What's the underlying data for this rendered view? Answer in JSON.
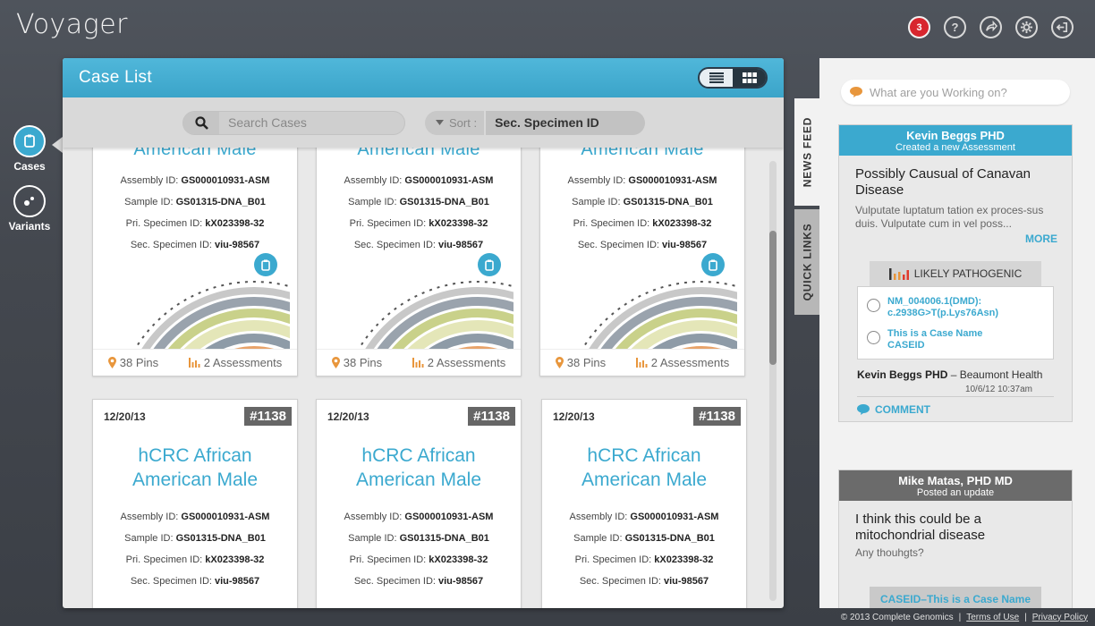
{
  "app": {
    "title": "Voyager"
  },
  "topbar": {
    "notification_count": "3",
    "icons": [
      "notifications-icon",
      "help-icon",
      "share-icon",
      "settings-icon",
      "logout-icon"
    ]
  },
  "leftnav": {
    "items": [
      {
        "label": "Cases",
        "active": true
      },
      {
        "label": "Variants",
        "active": false
      }
    ]
  },
  "case_list": {
    "title": "Case List",
    "search_placeholder": "Search Cases",
    "sort_label": "Sort :",
    "sort_value": "Sec. Specimen ID",
    "top_cards": [
      {
        "title_fragment": "American Male",
        "assembly_label": "Assembly ID:",
        "assembly": "GS000010931-ASM",
        "sample_label": "Sample ID:",
        "sample": "GS01315-DNA_B01",
        "pri_label": "Pri. Specimen ID:",
        "pri": "kX023398-32",
        "sec_label": "Sec. Specimen ID:",
        "sec": "viu-98567",
        "pins": "38 Pins",
        "assessments": "2 Assessments"
      },
      {
        "title_fragment": "American Male",
        "assembly_label": "Assembly ID:",
        "assembly": "GS000010931-ASM",
        "sample_label": "Sample ID:",
        "sample": "GS01315-DNA_B01",
        "pri_label": "Pri. Specimen ID:",
        "pri": "kX023398-32",
        "sec_label": "Sec. Specimen ID:",
        "sec": "viu-98567",
        "pins": "38 Pins",
        "assessments": "2 Assessments"
      },
      {
        "title_fragment": "American Male",
        "assembly_label": "Assembly ID:",
        "assembly": "GS000010931-ASM",
        "sample_label": "Sample ID:",
        "sample": "GS01315-DNA_B01",
        "pri_label": "Pri. Specimen ID:",
        "pri": "kX023398-32",
        "sec_label": "Sec. Specimen ID:",
        "sec": "viu-98567",
        "pins": "38 Pins",
        "assessments": "2 Assessments"
      }
    ],
    "bottom_cards": [
      {
        "date": "12/20/13",
        "id": "#1138",
        "title_line1": "hCRC African",
        "title_line2": "American Male",
        "assembly_label": "Assembly ID:",
        "assembly": "GS000010931-ASM",
        "sample_label": "Sample ID:",
        "sample": "GS01315-DNA_B01",
        "pri_label": "Pri. Specimen ID:",
        "pri": "kX023398-32",
        "sec_label": "Sec. Specimen ID:",
        "sec": "viu-98567"
      },
      {
        "date": "12/20/13",
        "id": "#1138",
        "title_line1": "hCRC African",
        "title_line2": "American Male",
        "assembly_label": "Assembly ID:",
        "assembly": "GS000010931-ASM",
        "sample_label": "Sample ID:",
        "sample": "GS01315-DNA_B01",
        "pri_label": "Pri. Specimen ID:",
        "pri": "kX023398-32",
        "sec_label": "Sec. Specimen ID:",
        "sec": "viu-98567"
      },
      {
        "date": "12/20/13",
        "id": "#1138",
        "title_line1": "hCRC African",
        "title_line2": "American Male",
        "assembly_label": "Assembly ID:",
        "assembly": "GS000010931-ASM",
        "sample_label": "Sample ID:",
        "sample": "GS01315-DNA_B01",
        "pri_label": "Pri. Specimen ID:",
        "pri": "kX023398-32",
        "sec_label": "Sec. Specimen ID:",
        "sec": "viu-98567"
      }
    ]
  },
  "side_tabs": {
    "news_feed": "NEWS FEED",
    "quick_links": "QUICK LINKS"
  },
  "feed": {
    "search_placeholder": "What are you Working on?",
    "post1": {
      "author": "Kevin Beggs PHD",
      "action": "Created a new Assessment",
      "heading": "Possibly Causual of Canavan Disease",
      "text": "Vulputate luptatum tation ex proces-sus duis. Vulputate cum in vel poss...",
      "more": "MORE",
      "badge": "LIKELY PATHOGENIC",
      "variant_line1": "NM_004006.1(DMD):",
      "variant_line2": "c.2938G>T(p.Lys76Asn)",
      "case_line1": "This is a Case Name",
      "case_line2": "CASEID",
      "meta_author": "Kevin Beggs PHD",
      "meta_org": " – Beaumont Health",
      "time": "10/6/12 10:37am",
      "comment": "COMMENT"
    },
    "post2": {
      "author": "Mike Matas, PHD MD",
      "action": "Posted an update",
      "heading": "I think this could be a mitochondrial disease",
      "text": "Any thouhgts?",
      "caseid": "CASEID–This is a Case Name"
    }
  },
  "footer": {
    "copyright": "© 2013 Complete Genomics",
    "terms": "Terms of Use",
    "privacy": "Privacy Policy"
  },
  "colors": {
    "accent": "#3ba9cf",
    "notification": "#d8262e",
    "header_dark": "#6b6b6b"
  }
}
